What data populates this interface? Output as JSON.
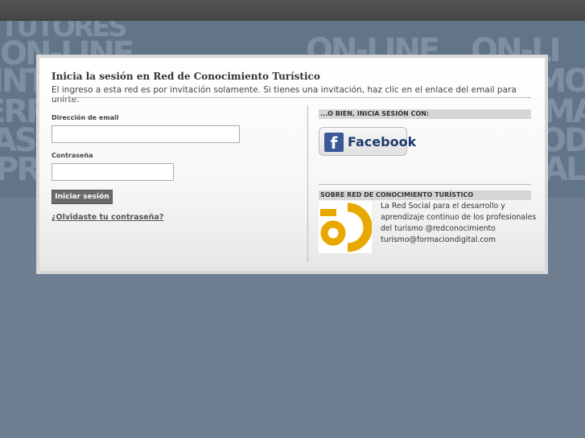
{
  "background": {
    "words": [
      "TUTORES",
      "ON-LINE",
      "ON-LINE",
      "ON-LI",
      "INTRO",
      "EMOCIO",
      "ERRA",
      "MA",
      "ASE",
      "ODU",
      "PRE",
      "ALI"
    ]
  },
  "login": {
    "title": "Inicia la sesión en Red de Conocimiento Turístico",
    "subtitle": "El ingreso a esta red es por invitación solamente. Si tienes una invitación, haz clic en el enlace del email para unirte.",
    "email_label": "Dirección de email",
    "email_value": "",
    "password_label": "Contraseña",
    "password_value": "",
    "submit_label": "Iniciar sesión",
    "forgot_label": "¿Olvidaste tu contraseña?"
  },
  "social": {
    "heading": "...O BIEN, INICIA SESIÓN CON:",
    "facebook_letter": "f",
    "facebook_label": "Facebook",
    "facebook_color": "#3b5998"
  },
  "about": {
    "heading": "SOBRE RED DE CONOCIMIENTO TURÍSTICO",
    "lines": [
      "La Red Social para el desarrollo y",
      "aprendizaje continuo de los profesionales",
      "del turismo @redconocimiento",
      "turismo@formaciondigital.com"
    ],
    "logo_color": "#e8a800"
  }
}
